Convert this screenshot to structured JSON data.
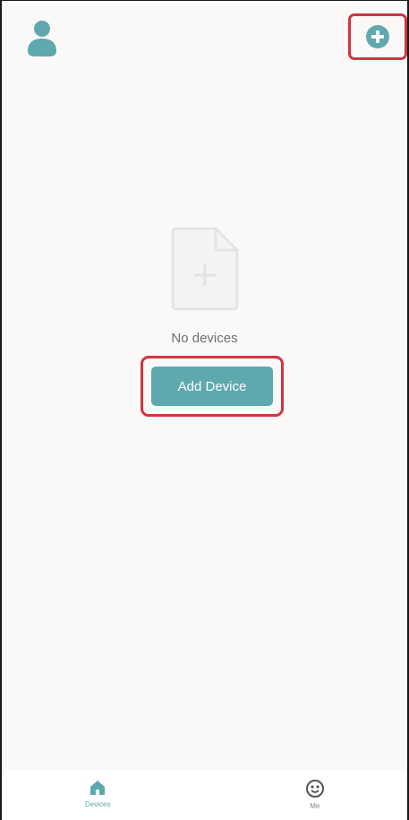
{
  "header": {
    "profile_icon": "user-icon",
    "add_icon": "plus-circle-icon"
  },
  "empty_state": {
    "icon": "document-plus-icon",
    "message": "No devices"
  },
  "add_device_button": {
    "label": "Add Device"
  },
  "bottom_nav": {
    "items": [
      {
        "label": "Devices",
        "icon": "home-icon",
        "active": true
      },
      {
        "label": "Me",
        "icon": "smiley-icon",
        "active": false
      }
    ]
  },
  "colors": {
    "accent": "#5ea9ad",
    "highlight": "#d3343f",
    "background": "#faf9f8"
  }
}
